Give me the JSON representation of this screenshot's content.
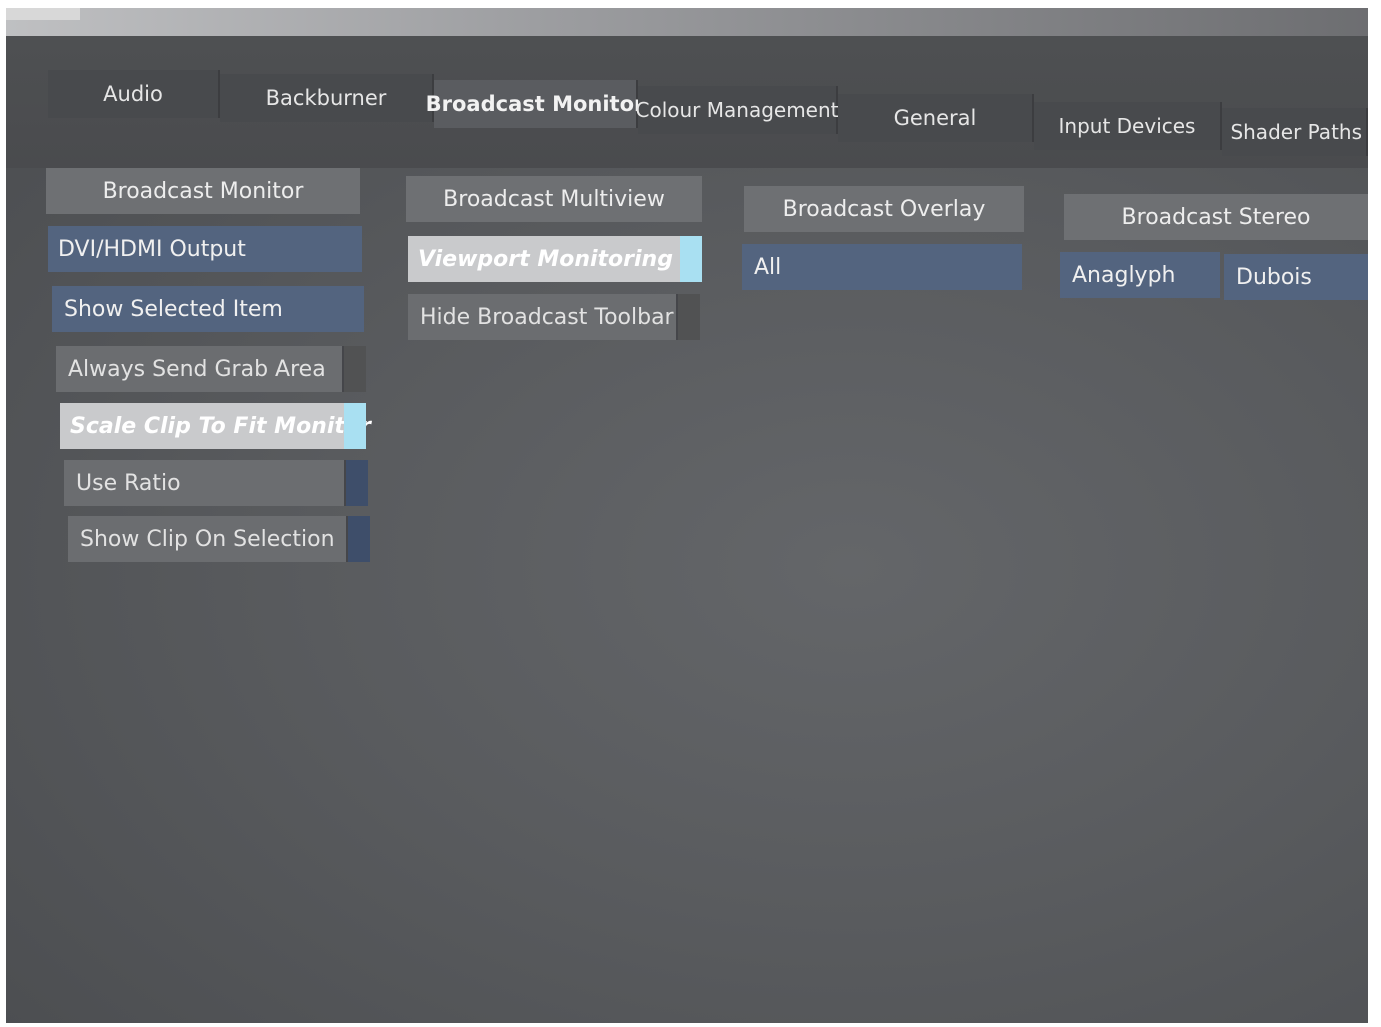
{
  "tabs": [
    {
      "label": "Audio",
      "active": false
    },
    {
      "label": "Backburner",
      "active": false
    },
    {
      "label": "Broadcast Monitor",
      "active": true
    },
    {
      "label": "Colour Management",
      "active": false
    },
    {
      "label": "General",
      "active": false
    },
    {
      "label": "Input Devices",
      "active": false
    },
    {
      "label": "Shader Paths",
      "active": false
    }
  ],
  "broadcast_monitor": {
    "header": "Broadcast Monitor",
    "dvi_hdmi_output": "DVI/HDMI Output",
    "show_selected_item": "Show Selected Item",
    "always_send_grab_area": "Always Send Grab Area",
    "scale_clip_to_fit_monitor": "Scale Clip To Fit Monitor",
    "use_ratio": "Use Ratio",
    "show_clip_on_selection": "Show Clip On Selection"
  },
  "broadcast_multiview": {
    "header": "Broadcast Multiview",
    "viewport_monitoring": "Viewport Monitoring",
    "hide_broadcast_toolbar": "Hide Broadcast Toolbar"
  },
  "broadcast_overlay": {
    "header": "Broadcast Overlay",
    "value": "All"
  },
  "broadcast_stereo": {
    "header": "Broadcast Stereo",
    "mode": "Anaglyph",
    "method": "Dubois"
  },
  "colors": {
    "selected_blue": "#53647f",
    "active_indicator": "#a9e0f2",
    "panel_gray": "#6b6d70"
  }
}
